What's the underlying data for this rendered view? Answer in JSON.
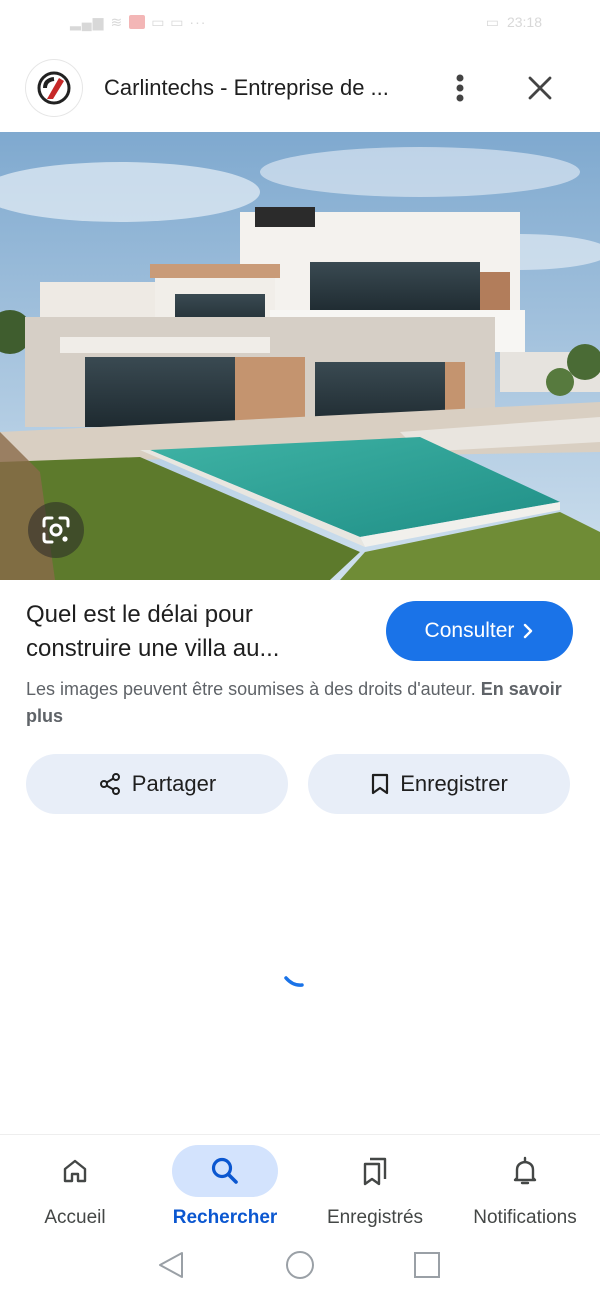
{
  "status_bar": {
    "left_icons": [
      "signal-icon",
      "wifi-icon",
      "notification-icons"
    ],
    "time": "23:18"
  },
  "header": {
    "title": "Carlintechs - Entreprise de ...",
    "logo_icon": "carlintechs-logo",
    "menu_icon": "more-vert-icon",
    "close_icon": "close-icon"
  },
  "hero": {
    "image_subject": "modern villa with pool",
    "lens_icon": "google-lens-icon"
  },
  "info": {
    "title": "Quel est le délai pour construire une villa au...",
    "consult_label": "Consulter",
    "copyright_text": "Les images peuvent être soumises à des droits d'auteur.",
    "learn_more": "En savoir plus"
  },
  "actions": {
    "share_label": "Partager",
    "save_label": "Enregistrer"
  },
  "bottom_nav": {
    "items": [
      {
        "label": "Accueil",
        "icon": "home-icon",
        "active": false
      },
      {
        "label": "Rechercher",
        "icon": "search-icon",
        "active": true
      },
      {
        "label": "Enregistrés",
        "icon": "bookmarks-icon",
        "active": false
      },
      {
        "label": "Notifications",
        "icon": "bell-icon",
        "active": false
      }
    ]
  },
  "colors": {
    "accent": "#1a73e8",
    "active_nav": "#0b57d0",
    "pill_bg": "#e8eef8",
    "active_pill_bg": "#d3e3fd"
  }
}
